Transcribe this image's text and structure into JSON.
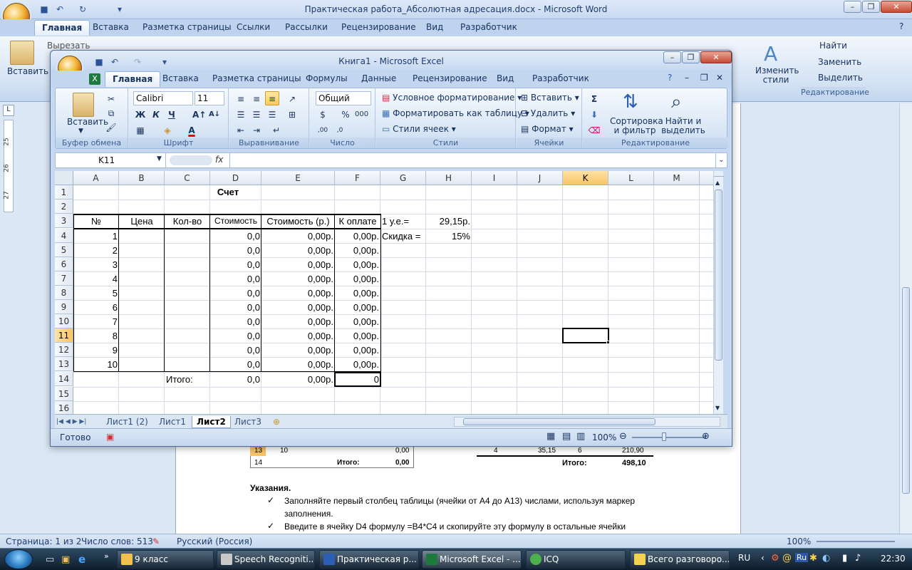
{
  "word": {
    "title": "Практическая работа_Абсолютная адресация.docx - Microsoft Word",
    "tabs": [
      "Главная",
      "Вставка",
      "Разметка страницы",
      "Ссылки",
      "Рассылки",
      "Рецензирование",
      "Вид",
      "Разработчик"
    ],
    "ribbon": {
      "paste": "Вставить",
      "cut": "Вырезать",
      "find": "Найти",
      "replace": "Заменить",
      "select": "Выделить",
      "change_styles": "Изменить стили",
      "group_edit": "Редактирование"
    },
    "doc": {
      "row13": [
        "13",
        "10",
        "0,00"
      ],
      "row14": [
        "14",
        "Итого:",
        "0,00"
      ],
      "right_row": [
        "4",
        "35,15",
        "6",
        "210,90"
      ],
      "right_total": [
        "Итого:",
        "498,10"
      ],
      "instructions_title": "Указания.",
      "bullet1": "Заполняйте первый столбец таблицы  (ячейки от А4 до А13) числами, используя маркер",
      "bullet1b": "заполнения.",
      "bullet2": "Введите  в  ячейку  D4  формулу  =B4*C4  и  скопируйте  эту  формулу  в  остальные  ячейки"
    },
    "ruler_marks": [
      "25",
      "26",
      "27"
    ],
    "status": {
      "page": "Страница: 1 из 2",
      "words": "Число слов: 513",
      "lang": "Русский (Россия)",
      "zoom": "100%"
    }
  },
  "excel": {
    "title": "Книга1 - Microsoft Excel",
    "tabs": [
      "Главная",
      "Вставка",
      "Разметка страницы",
      "Формулы",
      "Данные",
      "Рецензирование",
      "Вид",
      "Разработчик"
    ],
    "ribbon": {
      "paste": "Вставить",
      "clipboard": "Буфер обмена",
      "font_name": "Calibri",
      "font_size": "11",
      "font": "Шрифт",
      "alignment": "Выравнивание",
      "number_format": "Общий",
      "number": "Число",
      "cond_format": "Условное форматирование",
      "format_table": "Форматировать как таблицу",
      "cell_styles": "Стили ячеек",
      "styles": "Стили",
      "insert": "Вставить",
      "delete": "Удалить",
      "format": "Формат",
      "cells": "Ячейки",
      "sort": "Сортировка и фильтр",
      "find": "Найти и выделить",
      "editing": "Редактирование",
      "bold": "Ж",
      "italic": "К",
      "underline": "Ч"
    },
    "name_box": "K11",
    "fx": "fx",
    "columns": [
      "A",
      "B",
      "C",
      "D",
      "E",
      "F",
      "G",
      "H",
      "I",
      "J",
      "K",
      "L",
      "M"
    ],
    "rows": [
      "1",
      "2",
      "3",
      "4",
      "5",
      "6",
      "7",
      "8",
      "9",
      "10",
      "11",
      "12",
      "13",
      "14",
      "15",
      "16"
    ],
    "selected_cell": "K11",
    "cells": {
      "title": "Счет",
      "headers": [
        "№",
        "Цена",
        "Кол-во",
        "Стоимость",
        "Стоимость (р.)",
        "К оплате"
      ],
      "rate_label": "1 у.е.=",
      "rate_value": "29,15р.",
      "discount_label": "Скидка =",
      "discount_value": "15%",
      "numbers": [
        "1",
        "2",
        "3",
        "4",
        "5",
        "6",
        "7",
        "8",
        "9",
        "10"
      ],
      "cost": "0,0",
      "cost_rub": "0,00р.",
      "pay": "0,00р.",
      "total_label": "Итого:",
      "total_cost": "0,0",
      "total_rub": "0,00р.",
      "total_pay": "0"
    },
    "sheets": [
      "Лист1 (2)",
      "Лист1",
      "Лист2",
      "Лист3"
    ],
    "active_sheet": "Лист2",
    "status": {
      "ready": "Готово",
      "zoom": "100%"
    }
  },
  "taskbar": {
    "items": [
      "9 класс",
      "Speech Recogniti...",
      "Практическая р...",
      "Microsoft Excel - ...",
      "ICQ",
      "Всего разговоро..."
    ],
    "active_item": "Microsoft Excel - ...",
    "lang": "RU",
    "ru_badge": "Ru",
    "clock": "22:30"
  }
}
